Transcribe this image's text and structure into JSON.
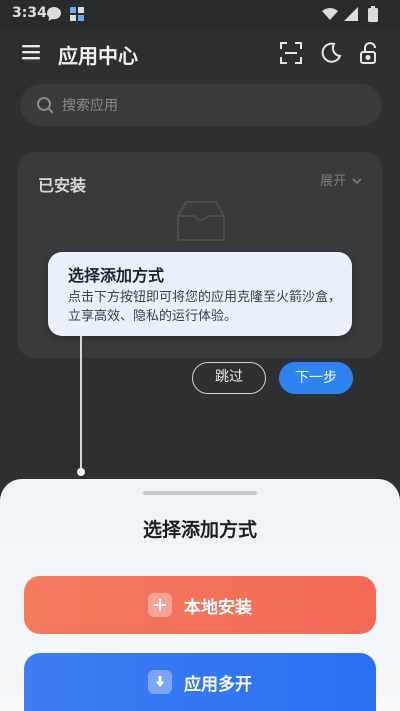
{
  "status_bar": {
    "time": "3:34"
  },
  "header": {
    "title": "应用中心",
    "icons": [
      "menu-icon",
      "scan-icon",
      "dark-mode-icon",
      "lock-icon"
    ]
  },
  "search": {
    "placeholder": "搜索应用"
  },
  "installed": {
    "title": "已安装",
    "expand_label": "展开"
  },
  "tooltip": {
    "title": "选择添加方式",
    "body": "点击下方按钮即可将您的应用克隆至火箭沙盒，立享高效、隐私的运行体验。"
  },
  "tour": {
    "skip_label": "跳过",
    "next_label": "下一步"
  },
  "sheet": {
    "title": "选择添加方式",
    "local_install_label": "本地安装",
    "multi_open_label": "应用多开"
  },
  "colors": {
    "accent_blue": "#2f84f2",
    "local_install": "#f47a5e",
    "multi_open": "#3f7ef5"
  }
}
